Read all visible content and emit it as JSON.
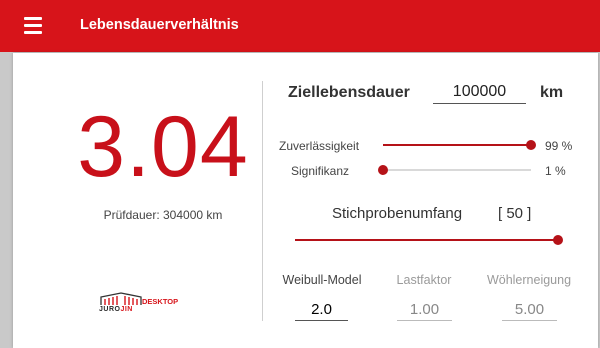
{
  "app": {
    "title": "Lebensdauerverhältnis"
  },
  "result": {
    "ratio": "3.04",
    "test_duration": "Prüfdauer: 304000 km"
  },
  "logo": {
    "brand_left": "JUROJIN",
    "brand_part1": "JURO",
    "brand_part2": "JIN",
    "brand_right": "DESKTOP"
  },
  "target": {
    "label": "Ziellebensdauer",
    "value": "100000",
    "unit": "km"
  },
  "reliability": {
    "label": "Zuverlässigkeit",
    "value_text": "99 %",
    "level": 1.0
  },
  "significance": {
    "label": "Signifikanz",
    "value_text": "1 %",
    "level": 0.0
  },
  "sample": {
    "label": "Stichprobenumfang",
    "value_text": "[ 50 ]",
    "level": 1.0
  },
  "params": {
    "weibull": {
      "label": "Weibull-Model",
      "value": "2.0"
    },
    "load": {
      "label": "Lastfaktor",
      "value": "1.00"
    },
    "woehler": {
      "label": "Wöhlerneigung",
      "value": "5.00"
    }
  },
  "colors": {
    "brand_red": "#d7141a",
    "value_red": "#c8101a",
    "slider_red": "#b51218"
  }
}
